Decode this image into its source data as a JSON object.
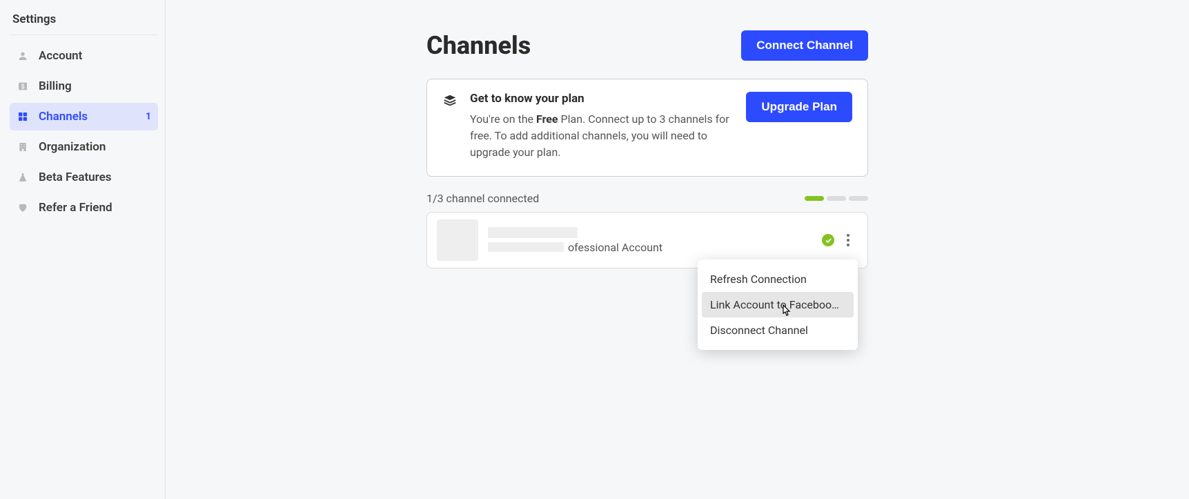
{
  "sidebar": {
    "title": "Settings",
    "items": [
      {
        "label": "Account"
      },
      {
        "label": "Billing"
      },
      {
        "label": "Channels",
        "badge": "1"
      },
      {
        "label": "Organization"
      },
      {
        "label": "Beta Features"
      },
      {
        "label": "Refer a Friend"
      }
    ]
  },
  "header": {
    "title": "Channels",
    "connect_label": "Connect Channel"
  },
  "plan": {
    "title": "Get to know your plan",
    "desc_pre": "You're on the ",
    "desc_strong": "Free",
    "desc_post": " Plan. Connect up to 3 channels for free. To add additional channels, you will need to upgrade your plan.",
    "upgrade_label": "Upgrade Plan"
  },
  "status": {
    "text": "1/3 channel connected"
  },
  "channel": {
    "account_type": "ofessional Account"
  },
  "dropdown": {
    "items": [
      "Refresh Connection",
      "Link Account to Faceboo…",
      "Disconnect Channel"
    ]
  }
}
